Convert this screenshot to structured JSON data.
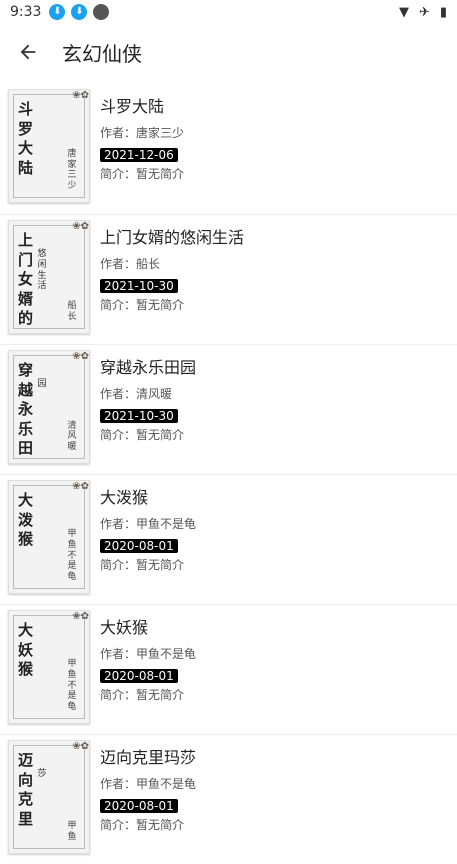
{
  "status": {
    "time": "9:33"
  },
  "header": {
    "title": "玄幻仙侠"
  },
  "books": [
    {
      "title": "斗罗大陆",
      "author": "作者：唐家三少",
      "date": "2021-12-06",
      "intro": "简介：暂无简介",
      "cover_title": [
        "斗",
        "罗",
        "大",
        "陆"
      ],
      "cover_author": [
        "唐",
        "家",
        "三",
        "少"
      ],
      "cover_sub": []
    },
    {
      "title": "上门女婿的悠闲生活",
      "author": "作者：船长",
      "date": "2021-10-30",
      "intro": "简介：暂无简介",
      "cover_title": [
        "上",
        "门",
        "女",
        "婿",
        "的"
      ],
      "cover_author": [
        "船",
        "长"
      ],
      "cover_sub": [
        "悠",
        "闲",
        "生",
        "活"
      ]
    },
    {
      "title": "穿越永乐田园",
      "author": "作者：清风暖",
      "date": "2021-10-30",
      "intro": "简介：暂无简介",
      "cover_title": [
        "穿",
        "越",
        "永",
        "乐",
        "田"
      ],
      "cover_author": [
        "清",
        "风",
        "暖"
      ],
      "cover_sub": [
        "园"
      ]
    },
    {
      "title": "大泼猴",
      "author": "作者：甲鱼不是龟",
      "date": "2020-08-01",
      "intro": "简介：暂无简介",
      "cover_title": [
        "大",
        "泼",
        "猴"
      ],
      "cover_author": [
        "甲",
        "鱼",
        "不",
        "是",
        "龟"
      ],
      "cover_sub": []
    },
    {
      "title": "大妖猴",
      "author": "作者：甲鱼不是龟",
      "date": "2020-08-01",
      "intro": "简介：暂无简介",
      "cover_title": [
        "大",
        "妖",
        "猴"
      ],
      "cover_author": [
        "甲",
        "鱼",
        "不",
        "是",
        "龟"
      ],
      "cover_sub": []
    },
    {
      "title": "迈向克里玛莎",
      "author": "作者：甲鱼不是龟",
      "date": "2020-08-01",
      "intro": "简介：暂无简介",
      "cover_title": [
        "迈",
        "向",
        "克",
        "里"
      ],
      "cover_author": [
        "甲",
        "鱼"
      ],
      "cover_sub": [
        "莎"
      ]
    }
  ]
}
